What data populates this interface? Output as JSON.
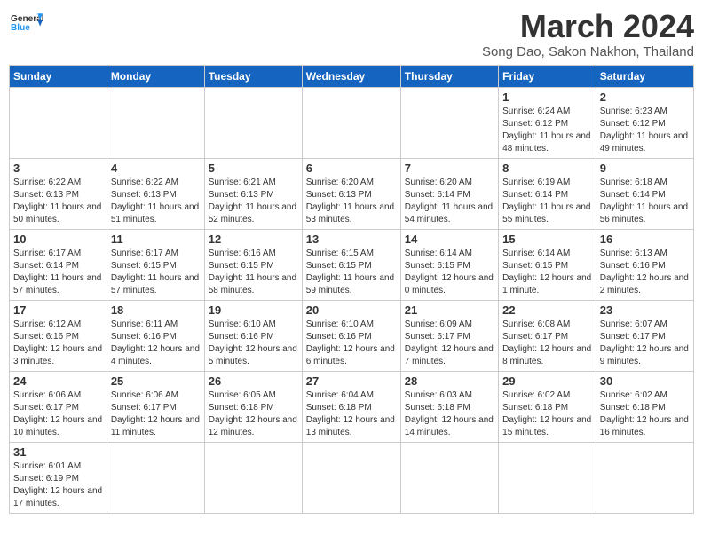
{
  "header": {
    "logo_general": "General",
    "logo_blue": "Blue",
    "month_year": "March 2024",
    "location": "Song Dao, Sakon Nakhon, Thailand"
  },
  "days_of_week": [
    "Sunday",
    "Monday",
    "Tuesday",
    "Wednesday",
    "Thursday",
    "Friday",
    "Saturday"
  ],
  "weeks": [
    [
      {
        "day": "",
        "info": ""
      },
      {
        "day": "",
        "info": ""
      },
      {
        "day": "",
        "info": ""
      },
      {
        "day": "",
        "info": ""
      },
      {
        "day": "",
        "info": ""
      },
      {
        "day": "1",
        "info": "Sunrise: 6:24 AM\nSunset: 6:12 PM\nDaylight: 11 hours and 48 minutes."
      },
      {
        "day": "2",
        "info": "Sunrise: 6:23 AM\nSunset: 6:12 PM\nDaylight: 11 hours and 49 minutes."
      }
    ],
    [
      {
        "day": "3",
        "info": "Sunrise: 6:22 AM\nSunset: 6:13 PM\nDaylight: 11 hours and 50 minutes."
      },
      {
        "day": "4",
        "info": "Sunrise: 6:22 AM\nSunset: 6:13 PM\nDaylight: 11 hours and 51 minutes."
      },
      {
        "day": "5",
        "info": "Sunrise: 6:21 AM\nSunset: 6:13 PM\nDaylight: 11 hours and 52 minutes."
      },
      {
        "day": "6",
        "info": "Sunrise: 6:20 AM\nSunset: 6:13 PM\nDaylight: 11 hours and 53 minutes."
      },
      {
        "day": "7",
        "info": "Sunrise: 6:20 AM\nSunset: 6:14 PM\nDaylight: 11 hours and 54 minutes."
      },
      {
        "day": "8",
        "info": "Sunrise: 6:19 AM\nSunset: 6:14 PM\nDaylight: 11 hours and 55 minutes."
      },
      {
        "day": "9",
        "info": "Sunrise: 6:18 AM\nSunset: 6:14 PM\nDaylight: 11 hours and 56 minutes."
      }
    ],
    [
      {
        "day": "10",
        "info": "Sunrise: 6:17 AM\nSunset: 6:14 PM\nDaylight: 11 hours and 57 minutes."
      },
      {
        "day": "11",
        "info": "Sunrise: 6:17 AM\nSunset: 6:15 PM\nDaylight: 11 hours and 57 minutes."
      },
      {
        "day": "12",
        "info": "Sunrise: 6:16 AM\nSunset: 6:15 PM\nDaylight: 11 hours and 58 minutes."
      },
      {
        "day": "13",
        "info": "Sunrise: 6:15 AM\nSunset: 6:15 PM\nDaylight: 11 hours and 59 minutes."
      },
      {
        "day": "14",
        "info": "Sunrise: 6:14 AM\nSunset: 6:15 PM\nDaylight: 12 hours and 0 minutes."
      },
      {
        "day": "15",
        "info": "Sunrise: 6:14 AM\nSunset: 6:15 PM\nDaylight: 12 hours and 1 minute."
      },
      {
        "day": "16",
        "info": "Sunrise: 6:13 AM\nSunset: 6:16 PM\nDaylight: 12 hours and 2 minutes."
      }
    ],
    [
      {
        "day": "17",
        "info": "Sunrise: 6:12 AM\nSunset: 6:16 PM\nDaylight: 12 hours and 3 minutes."
      },
      {
        "day": "18",
        "info": "Sunrise: 6:11 AM\nSunset: 6:16 PM\nDaylight: 12 hours and 4 minutes."
      },
      {
        "day": "19",
        "info": "Sunrise: 6:10 AM\nSunset: 6:16 PM\nDaylight: 12 hours and 5 minutes."
      },
      {
        "day": "20",
        "info": "Sunrise: 6:10 AM\nSunset: 6:16 PM\nDaylight: 12 hours and 6 minutes."
      },
      {
        "day": "21",
        "info": "Sunrise: 6:09 AM\nSunset: 6:17 PM\nDaylight: 12 hours and 7 minutes."
      },
      {
        "day": "22",
        "info": "Sunrise: 6:08 AM\nSunset: 6:17 PM\nDaylight: 12 hours and 8 minutes."
      },
      {
        "day": "23",
        "info": "Sunrise: 6:07 AM\nSunset: 6:17 PM\nDaylight: 12 hours and 9 minutes."
      }
    ],
    [
      {
        "day": "24",
        "info": "Sunrise: 6:06 AM\nSunset: 6:17 PM\nDaylight: 12 hours and 10 minutes."
      },
      {
        "day": "25",
        "info": "Sunrise: 6:06 AM\nSunset: 6:17 PM\nDaylight: 12 hours and 11 minutes."
      },
      {
        "day": "26",
        "info": "Sunrise: 6:05 AM\nSunset: 6:18 PM\nDaylight: 12 hours and 12 minutes."
      },
      {
        "day": "27",
        "info": "Sunrise: 6:04 AM\nSunset: 6:18 PM\nDaylight: 12 hours and 13 minutes."
      },
      {
        "day": "28",
        "info": "Sunrise: 6:03 AM\nSunset: 6:18 PM\nDaylight: 12 hours and 14 minutes."
      },
      {
        "day": "29",
        "info": "Sunrise: 6:02 AM\nSunset: 6:18 PM\nDaylight: 12 hours and 15 minutes."
      },
      {
        "day": "30",
        "info": "Sunrise: 6:02 AM\nSunset: 6:18 PM\nDaylight: 12 hours and 16 minutes."
      }
    ],
    [
      {
        "day": "31",
        "info": "Sunrise: 6:01 AM\nSunset: 6:19 PM\nDaylight: 12 hours and 17 minutes."
      },
      {
        "day": "",
        "info": ""
      },
      {
        "day": "",
        "info": ""
      },
      {
        "day": "",
        "info": ""
      },
      {
        "day": "",
        "info": ""
      },
      {
        "day": "",
        "info": ""
      },
      {
        "day": "",
        "info": ""
      }
    ]
  ]
}
